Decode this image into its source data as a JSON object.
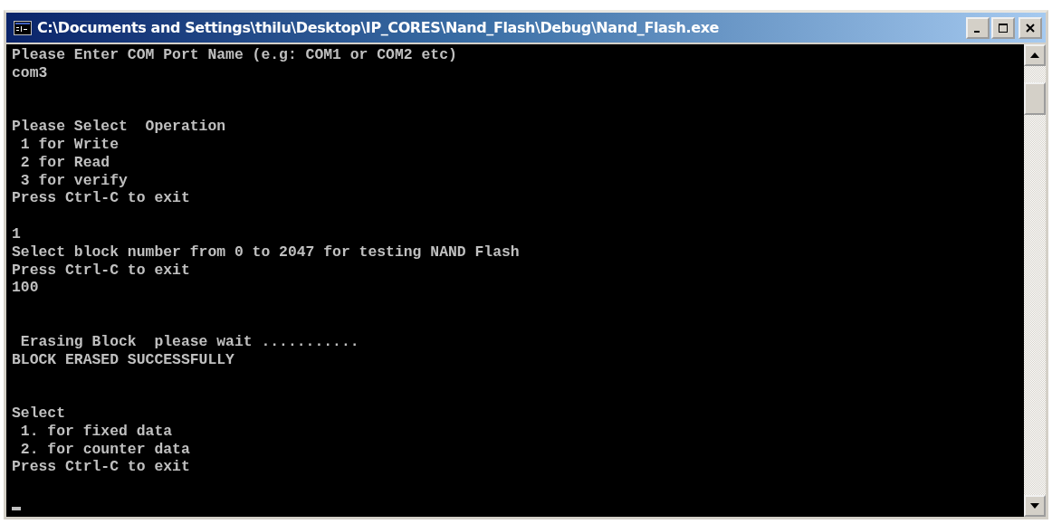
{
  "window": {
    "title": "C:\\Documents and Settings\\thilu\\Desktop\\IP_CORES\\Nand_Flash\\Debug\\Nand_Flash.exe"
  },
  "console": {
    "lines": [
      {
        "kind": "text",
        "text": "Please Enter COM Port Name (e.g: COM1 or COM2 etc)"
      },
      {
        "kind": "text",
        "text": "com3"
      },
      {
        "kind": "blank"
      },
      {
        "kind": "blank"
      },
      {
        "kind": "text",
        "text": "Please Select  Operation"
      },
      {
        "kind": "text",
        "text": " 1 for Write"
      },
      {
        "kind": "text",
        "text": " 2 for Read"
      },
      {
        "kind": "text",
        "text": " 3 for verify"
      },
      {
        "kind": "text",
        "text": "Press Ctrl-C to exit"
      },
      {
        "kind": "blank"
      },
      {
        "kind": "text",
        "text": "1"
      },
      {
        "kind": "text",
        "text": "Select block number from 0 to 2047 for testing NAND Flash"
      },
      {
        "kind": "text",
        "text": "Press Ctrl-C to exit"
      },
      {
        "kind": "text",
        "text": "100"
      },
      {
        "kind": "blank"
      },
      {
        "kind": "blank"
      },
      {
        "kind": "text",
        "text": " Erasing Block  please wait ..........."
      },
      {
        "kind": "text",
        "text": "BLOCK ERASED SUCCESSFULLY"
      },
      {
        "kind": "blank"
      },
      {
        "kind": "blank"
      },
      {
        "kind": "text",
        "text": "Select"
      },
      {
        "kind": "text",
        "text": " 1. for fixed data"
      },
      {
        "kind": "text",
        "text": " 2. for counter data"
      },
      {
        "kind": "text",
        "text": "Press Ctrl-C to exit"
      },
      {
        "kind": "blank"
      },
      {
        "kind": "cursor"
      }
    ]
  }
}
